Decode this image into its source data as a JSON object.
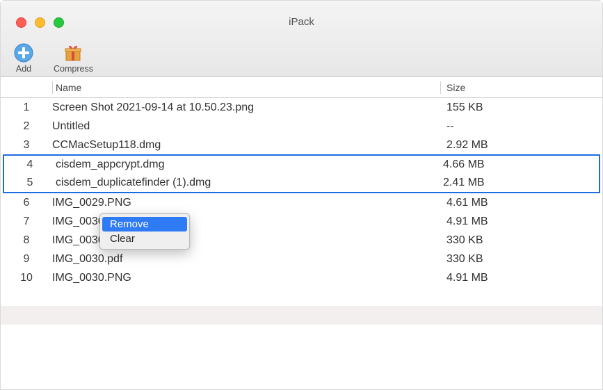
{
  "window": {
    "title": "iPack"
  },
  "toolbar": {
    "add_label": "Add",
    "compress_label": "Compress"
  },
  "columns": {
    "name": "Name",
    "size": "Size"
  },
  "rows": [
    {
      "index": "1",
      "name": "Screen Shot 2021-09-14 at 10.50.23.png",
      "size": "155 KB",
      "selected": false
    },
    {
      "index": "2",
      "name": "Untitled",
      "size": "--",
      "selected": false
    },
    {
      "index": "3",
      "name": "CCMacSetup118.dmg",
      "size": "2.92 MB",
      "selected": false
    },
    {
      "index": "4",
      "name": "cisdem_appcrypt.dmg",
      "size": "4.66 MB",
      "selected": true
    },
    {
      "index": "5",
      "name": "cisdem_duplicatefinder (1).dmg",
      "size": "2.41 MB",
      "selected": true
    },
    {
      "index": "6",
      "name": "IMG_0029.PNG",
      "size": "4.61 MB",
      "selected": false
    },
    {
      "index": "7",
      "name": "IMG_0030 (1).PNG",
      "size": "4.91 MB",
      "selected": false
    },
    {
      "index": "8",
      "name": "IMG_0030 2.pdf",
      "size": "330 KB",
      "selected": false
    },
    {
      "index": "9",
      "name": "IMG_0030.pdf",
      "size": "330 KB",
      "selected": false
    },
    {
      "index": "10",
      "name": "IMG_0030.PNG",
      "size": "4.91 MB",
      "selected": false
    }
  ],
  "context_menu": {
    "remove": "Remove",
    "clear": "Clear",
    "highlighted": "remove"
  }
}
